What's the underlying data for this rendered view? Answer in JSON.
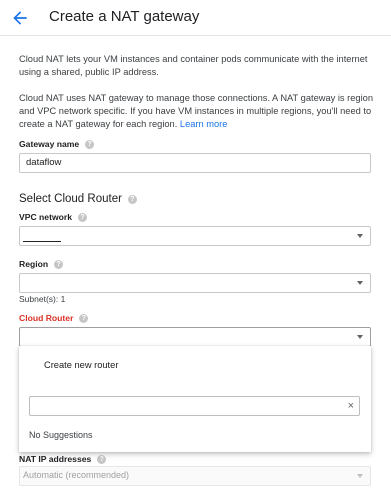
{
  "header": {
    "title": "Create a NAT gateway",
    "back_icon": "arrow-back-icon"
  },
  "intro": {
    "paragraph1": "Cloud NAT lets your VM instances and container pods communicate with the internet using a shared, public IP address.",
    "paragraph2": "Cloud NAT uses NAT gateway to manage those connections. A NAT gateway is region and VPC network specific. If you have VM instances in multiple regions, you'll need to create a NAT gateway for each region.",
    "learn_more": "Learn more"
  },
  "gateway_name": {
    "label": "Gateway name",
    "value": "dataflow"
  },
  "cloud_router_section": {
    "title": "Select Cloud Router"
  },
  "vpc_network": {
    "label": "VPC network",
    "value": ""
  },
  "region": {
    "label": "Region",
    "value": "",
    "subnets": "Subnet(s): 1"
  },
  "cloud_router": {
    "label": "Cloud Router",
    "value": "",
    "dropdown": {
      "create_option": "Create new router",
      "search_value": "",
      "clear_icon": "×",
      "no_suggestions": "No Suggestions"
    }
  },
  "nat_ip": {
    "label": "NAT IP addresses",
    "value": "Automatic (recommended)"
  },
  "colors": {
    "accent": "#1a73e8",
    "error": "#d93025",
    "text": "#212121"
  }
}
